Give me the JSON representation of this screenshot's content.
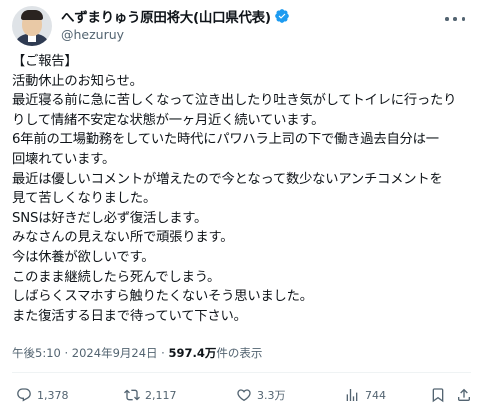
{
  "author": {
    "display_name": "へずまりゅう原田将大(山口県代表)",
    "handle": "@hezuruy",
    "verified_color": "#1d9bf0"
  },
  "post": {
    "lines": [
      "【ご報告】",
      "活動休止のお知らせ。",
      "最近寝る前に急に苦しくなって泣き出したり吐き気がしてトイレに行ったり",
      "りして情緒不安定な状態が一ヶ月近く続いています。",
      "6年前の工場勤務をしていた時代にパワハラ上司の下で働き過去自分は一",
      "回壊れています。",
      "最近は優しいコメントが増えたので今となって数少ないアンチコメントを",
      "見て苦しくなりました。",
      "SNSは好きだし必ず復活します。",
      "みなさんの見えない所で頑張ります。",
      "今は休養が欲しいです。",
      "このまま継続したら死んでしまう。",
      "しばらくスマホすら触りたくないそう思いました。",
      "また復活する日まで待っていて下さい。"
    ],
    "time": "午後5:10",
    "separator": "·",
    "date": "2024年9月24日",
    "views_count": "597.4万",
    "views_label": "件の表示"
  },
  "actions": {
    "replies": "1,378",
    "reposts": "2,117",
    "likes": "3.3万",
    "views": "744"
  },
  "colors": {
    "text": "#0f1419",
    "muted": "#536471",
    "divider": "#eff3f4"
  }
}
